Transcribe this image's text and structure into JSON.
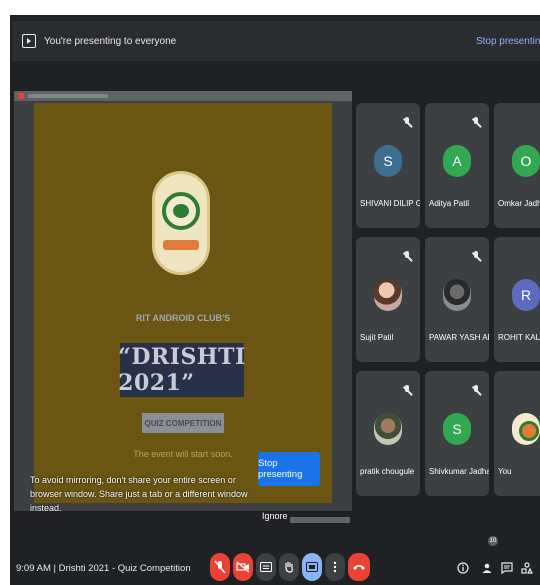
{
  "banner": {
    "message": "You're presenting to everyone",
    "stop_link": "Stop presenting"
  },
  "slide": {
    "club": "RIT ANDROID CLUB'S",
    "title": "“DRISHTI 2021”",
    "quiz": "QUIZ COMPETITION",
    "start_note": "The event will start soon."
  },
  "presenting_notice": {
    "stop_button": "Stop presenting",
    "warning": "To avoid mirroring, don't share your entire screen or browser window. Share just a tab or a different window instead.",
    "ignore": "Ignore"
  },
  "participants": [
    {
      "name": "SHIVANI DILIP GAI...",
      "initial": "S",
      "color": "#3c6e8f"
    },
    {
      "name": "Aditya Patil",
      "initial": "A",
      "color": "#33a852"
    },
    {
      "name": "Omkar Jadhav",
      "initial": "O",
      "color": "#33a852"
    },
    {
      "name": "Sujit Patil",
      "initial": "",
      "color": "#000000"
    },
    {
      "name": "PAWAR YASH ADH...",
      "initial": "",
      "color": "#000000"
    },
    {
      "name": "ROHIT KALUBAR...",
      "initial": "R",
      "color": "#5c6bc0"
    },
    {
      "name": "pratik chougule",
      "initial": "",
      "color": "#000000"
    },
    {
      "name": "Shivkumar Jadhav",
      "initial": "S",
      "color": "#33a852"
    },
    {
      "name": "You",
      "initial": "",
      "color": "#000000"
    }
  ],
  "bottom_bar": {
    "time": "9:09 AM",
    "separator": "|",
    "meeting_title": "Drishti 2021 - Quiz Competition",
    "participant_count": "10"
  },
  "icons": {
    "mic_off": "mic-off-icon",
    "camera_off": "camera-off-icon",
    "captions": "captions-icon",
    "raise_hand": "raise-hand-icon",
    "present": "present-icon",
    "more": "more-options-icon",
    "end_call": "end-call-icon",
    "info": "info-icon",
    "people": "people-icon",
    "chat": "chat-icon",
    "activities": "activities-icon"
  }
}
